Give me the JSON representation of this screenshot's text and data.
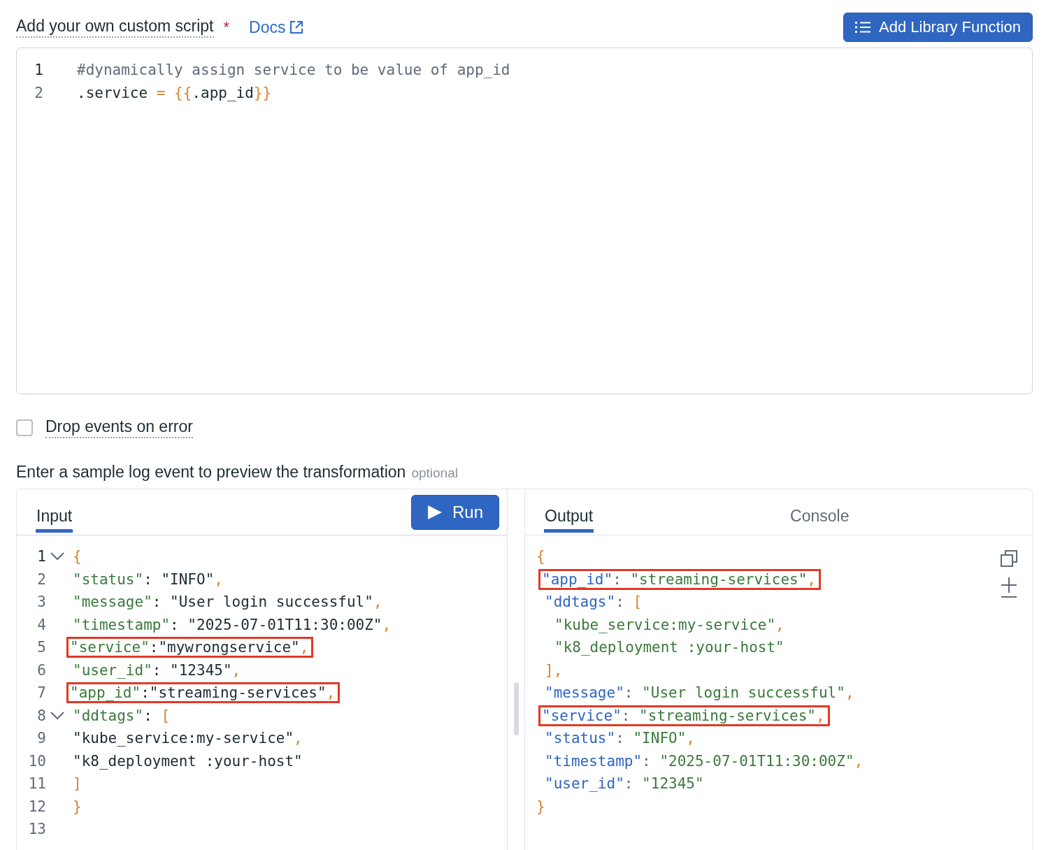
{
  "script_section": {
    "label": "Add your own custom script",
    "required_mark": "*",
    "docs_link": "Docs",
    "add_button": "Add Library Function",
    "lines": [
      {
        "no": "1",
        "tokens": [
          {
            "kind": "comment",
            "t": "#dynamically assign service to be value of app_id"
          }
        ]
      },
      {
        "no": "2",
        "tokens": [
          {
            "kind": "plain",
            "t": ".service"
          },
          {
            "kind": "punct",
            "t": " = {{"
          },
          {
            "kind": "plain",
            "t": ".app_id"
          },
          {
            "kind": "punct",
            "t": "}}"
          }
        ]
      }
    ]
  },
  "drop_events": {
    "label": "Drop events on error",
    "checked": false
  },
  "preview": {
    "title": "Enter a sample log event to preview the transformation",
    "hint": "optional",
    "input": {
      "tabs": [
        {
          "label": "Input",
          "selected": true
        }
      ],
      "run_button": "Run",
      "lines": [
        {
          "no": "1",
          "fold": true,
          "highlighted": false,
          "tokens": [
            {
              "kind": "punct",
              "t": "{"
            }
          ]
        },
        {
          "no": "2",
          "fold": false,
          "highlighted": false,
          "tokens": [
            {
              "kind": "key",
              "t": "\"status\""
            },
            {
              "kind": "plain",
              "t": ": \"INFO\""
            },
            {
              "kind": "punct",
              "t": ","
            }
          ]
        },
        {
          "no": "3",
          "fold": false,
          "highlighted": false,
          "tokens": [
            {
              "kind": "key",
              "t": "\"message\""
            },
            {
              "kind": "plain",
              "t": ": \"User login successful\""
            },
            {
              "kind": "punct",
              "t": ","
            }
          ]
        },
        {
          "no": "4",
          "fold": false,
          "highlighted": false,
          "tokens": [
            {
              "kind": "key",
              "t": "\"timestamp\""
            },
            {
              "kind": "plain",
              "t": ": \"2025-07-01T11:30:00Z\""
            },
            {
              "kind": "punct",
              "t": ","
            }
          ]
        },
        {
          "no": "5",
          "fold": false,
          "highlighted": true,
          "tokens": [
            {
              "kind": "key",
              "t": "\"service\""
            },
            {
              "kind": "plain",
              "t": ":\"mywrongservice\""
            },
            {
              "kind": "punct",
              "t": ","
            }
          ]
        },
        {
          "no": "6",
          "fold": false,
          "highlighted": false,
          "tokens": [
            {
              "kind": "key",
              "t": "\"user_id\""
            },
            {
              "kind": "plain",
              "t": ": \"12345\""
            },
            {
              "kind": "punct",
              "t": ","
            }
          ]
        },
        {
          "no": "7",
          "fold": false,
          "highlighted": true,
          "tokens": [
            {
              "kind": "key",
              "t": "\"app_id\""
            },
            {
              "kind": "plain",
              "t": ":\"streaming-services\""
            },
            {
              "kind": "punct",
              "t": ","
            }
          ]
        },
        {
          "no": "8",
          "fold": true,
          "highlighted": false,
          "tokens": [
            {
              "kind": "key",
              "t": "\"ddtags\""
            },
            {
              "kind": "plain",
              "t": ": "
            },
            {
              "kind": "punct",
              "t": "["
            }
          ]
        },
        {
          "no": "9",
          "fold": false,
          "highlighted": false,
          "tokens": [
            {
              "kind": "plain",
              "t": "\"kube_service:my-service\""
            },
            {
              "kind": "punct",
              "t": ","
            }
          ]
        },
        {
          "no": "10",
          "fold": false,
          "highlighted": false,
          "tokens": [
            {
              "kind": "plain",
              "t": "\"k8_deployment :your-host\""
            }
          ]
        },
        {
          "no": "11",
          "fold": false,
          "highlighted": false,
          "tokens": [
            {
              "kind": "punct",
              "t": "]"
            }
          ]
        },
        {
          "no": "12",
          "fold": false,
          "highlighted": false,
          "tokens": [
            {
              "kind": "punct",
              "t": "}"
            }
          ]
        },
        {
          "no": "13",
          "fold": false
        }
      ]
    },
    "output": {
      "tabs": [
        {
          "label": "Output",
          "selected": true
        },
        {
          "label": "Console",
          "selected": false
        }
      ],
      "lines": [
        {
          "kind": "bracket",
          "highlighted": false,
          "tokens": [
            {
              "kind": "punct",
              "t": "{"
            }
          ]
        },
        {
          "kind": "entry",
          "highlighted": true,
          "tokens": [
            {
              "kind": "key",
              "t": "\"app_id\""
            },
            {
              "kind": "plain",
              "t": ": "
            },
            {
              "kind": "string",
              "t": "\"streaming-services\""
            },
            {
              "kind": "punct",
              "t": ","
            }
          ]
        },
        {
          "kind": "entry",
          "highlighted": false,
          "tokens": [
            {
              "kind": "key",
              "t": "\"ddtags\""
            },
            {
              "kind": "plain",
              "t": ": "
            },
            {
              "kind": "punct",
              "t": "["
            }
          ]
        },
        {
          "kind": "item",
          "highlighted": false,
          "tokens": [
            {
              "kind": "string",
              "t": "\"kube_service:my-service\""
            },
            {
              "kind": "punct",
              "t": ","
            }
          ]
        },
        {
          "kind": "item",
          "highlighted": false,
          "tokens": [
            {
              "kind": "string",
              "t": "\"k8_deployment :your-host\""
            }
          ]
        },
        {
          "kind": "entry",
          "highlighted": false,
          "tokens": [
            {
              "kind": "punct",
              "t": "],"
            }
          ]
        },
        {
          "kind": "entry",
          "highlighted": false,
          "tokens": [
            {
              "kind": "key",
              "t": "\"message\""
            },
            {
              "kind": "plain",
              "t": ": "
            },
            {
              "kind": "string",
              "t": "\"User login successful\""
            },
            {
              "kind": "punct",
              "t": ","
            }
          ]
        },
        {
          "kind": "entry",
          "highlighted": true,
          "tokens": [
            {
              "kind": "key",
              "t": "\"service\""
            },
            {
              "kind": "plain",
              "t": ": "
            },
            {
              "kind": "string",
              "t": "\"streaming-services\""
            },
            {
              "kind": "punct",
              "t": ","
            }
          ]
        },
        {
          "kind": "entry",
          "highlighted": false,
          "tokens": [
            {
              "kind": "key",
              "t": "\"status\""
            },
            {
              "kind": "plain",
              "t": ": "
            },
            {
              "kind": "string",
              "t": "\"INFO\""
            },
            {
              "kind": "punct",
              "t": ","
            }
          ]
        },
        {
          "kind": "entry",
          "highlighted": false,
          "tokens": [
            {
              "kind": "key",
              "t": "\"timestamp\""
            },
            {
              "kind": "plain",
              "t": ": "
            },
            {
              "kind": "string",
              "t": "\"2025-07-01T11:30:00Z\""
            },
            {
              "kind": "punct",
              "t": ","
            }
          ]
        },
        {
          "kind": "entry",
          "highlighted": false,
          "tokens": [
            {
              "kind": "key",
              "t": "\"user_id\""
            },
            {
              "kind": "plain",
              "t": ": "
            },
            {
              "kind": "string",
              "t": "\"12345\""
            }
          ]
        },
        {
          "kind": "bracket",
          "highlighted": false,
          "tokens": [
            {
              "kind": "punct",
              "t": "}"
            }
          ]
        }
      ]
    }
  }
}
